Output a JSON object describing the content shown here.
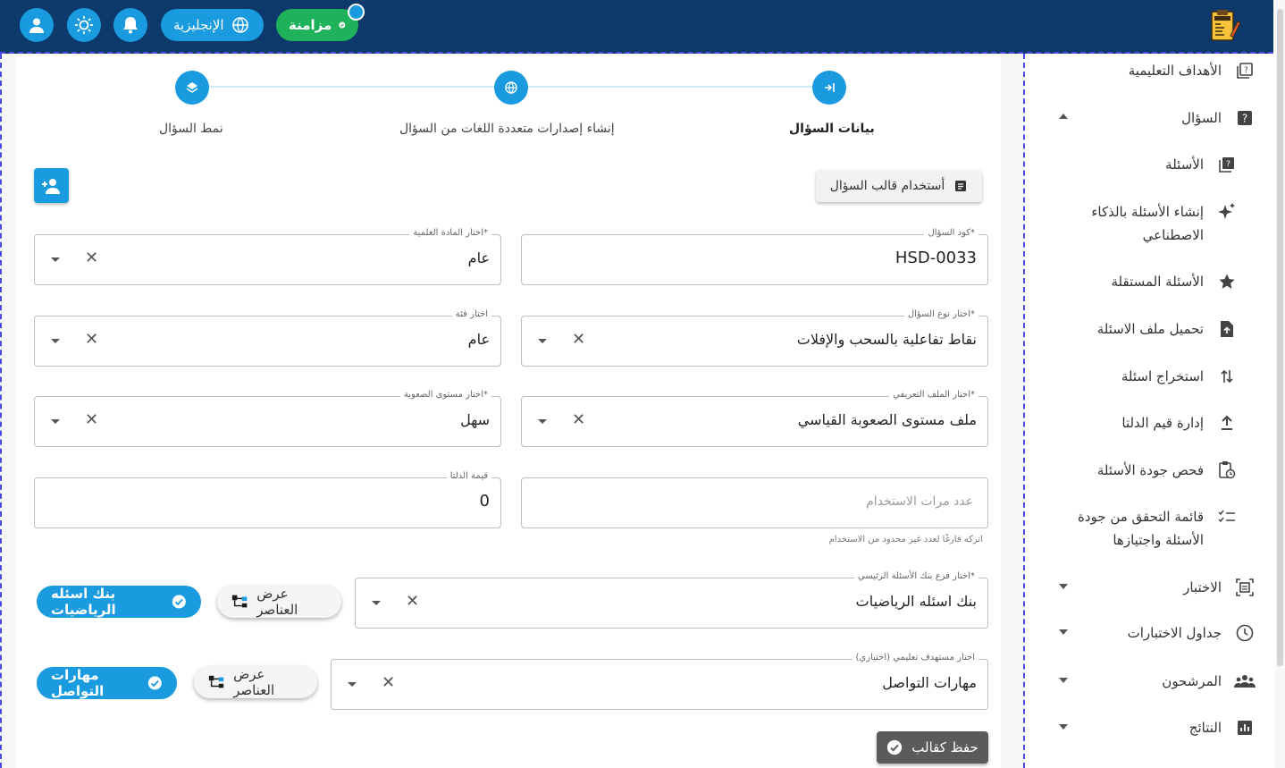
{
  "topbar": {
    "language_label": "الإنجليزية",
    "sync_label": "مزامنة",
    "icons": [
      "user-icon",
      "brightness-icon",
      "bell-icon",
      "globe-icon",
      "check-circle-icon"
    ],
    "colors": {
      "bar": "#0d3a6b",
      "accent": "#1a9be0",
      "sync": "#1fb25a"
    }
  },
  "sidebar": {
    "items": [
      {
        "label": "الأهداف التعليمية",
        "icon": "quiz-book-icon"
      },
      {
        "label": "السؤال",
        "icon": "question-icon",
        "expanded": true
      },
      {
        "label": "الأسئلة",
        "icon": "quiz-book-icon"
      },
      {
        "label_line1": "إنشاء الأسئلة بالذكاء",
        "label_line2": "الاصطناعي",
        "icon": "sparkle-icon"
      },
      {
        "label": "الأسئلة المستقلة",
        "icon": "star-icon"
      },
      {
        "label": "تحميل ملف الاسئلة",
        "icon": "file-upload-icon"
      },
      {
        "label": "استخراج اسئلة",
        "icon": "swap-vertical-icon"
      },
      {
        "label": "إدارة قيم الدلتا",
        "icon": "upload-icon"
      },
      {
        "label": "فحص جودة الأسئلة",
        "icon": "clipboard-clock-icon"
      },
      {
        "label_line1": "قائمة التحقق من جودة",
        "label_line2": "الأسئلة واجتيازها",
        "icon": "checklist-icon"
      },
      {
        "label": "الاختبار",
        "icon": "exam-frame-icon",
        "expandable": true
      },
      {
        "label": "جداول الاختبارات",
        "icon": "clock-icon",
        "expandable": true
      },
      {
        "label": "المرشحون",
        "icon": "group-icon",
        "expandable": true
      },
      {
        "label": "النتائج",
        "icon": "bar-chart-icon",
        "expandable": true
      }
    ]
  },
  "stepper": {
    "steps": [
      {
        "label": "بيانات السؤال",
        "icon": "login-arrow-icon",
        "active": true
      },
      {
        "label": "إنشاء إصدارات متعددة اللغات من السؤال",
        "icon": "globe-icon",
        "active": false
      },
      {
        "label": "نمط السؤال",
        "icon": "layers-icon",
        "active": false
      }
    ]
  },
  "form": {
    "template_button": "أستخدام قالب السؤال",
    "question_code": {
      "label": "كود السؤال*",
      "value": "HSD-0033"
    },
    "subject": {
      "label": "اختار المادة العلمية*",
      "value": "عام"
    },
    "question_type": {
      "label": "اختار نوع السؤال*",
      "value": "نقاط تفاعلية بالسحب والإفلات"
    },
    "category": {
      "label": "اختار فئة",
      "value": "عام"
    },
    "profile": {
      "label": "اختار الملف التعريفي*",
      "value": "ملف مستوى الصعوبة القياسي"
    },
    "difficulty": {
      "label": "اختار مستوى الصعوبة*",
      "value": "سهل"
    },
    "usage_count": {
      "placeholder": "عدد مرات الاستخدام",
      "helper": "اتركه فارغًا لعدد غير محدود من الاستخدام"
    },
    "delta": {
      "label": "قيمة الدلتا",
      "value": "0"
    },
    "bank_branch": {
      "label": "اختار فرع بنك الأسئلة الرئيسي*",
      "value": "بنك اسئله الرياضيات",
      "chip": "بنك اسئله الرياضيات",
      "view_button": "عرض العناصر"
    },
    "learning_target": {
      "label": "اختار مستهدف تعليمي (اختياري)",
      "value": "مهارات التواصل",
      "chip": "مهارات التواصل",
      "view_button": "عرض العناصر"
    },
    "save_template": "حفظ كقالب"
  }
}
